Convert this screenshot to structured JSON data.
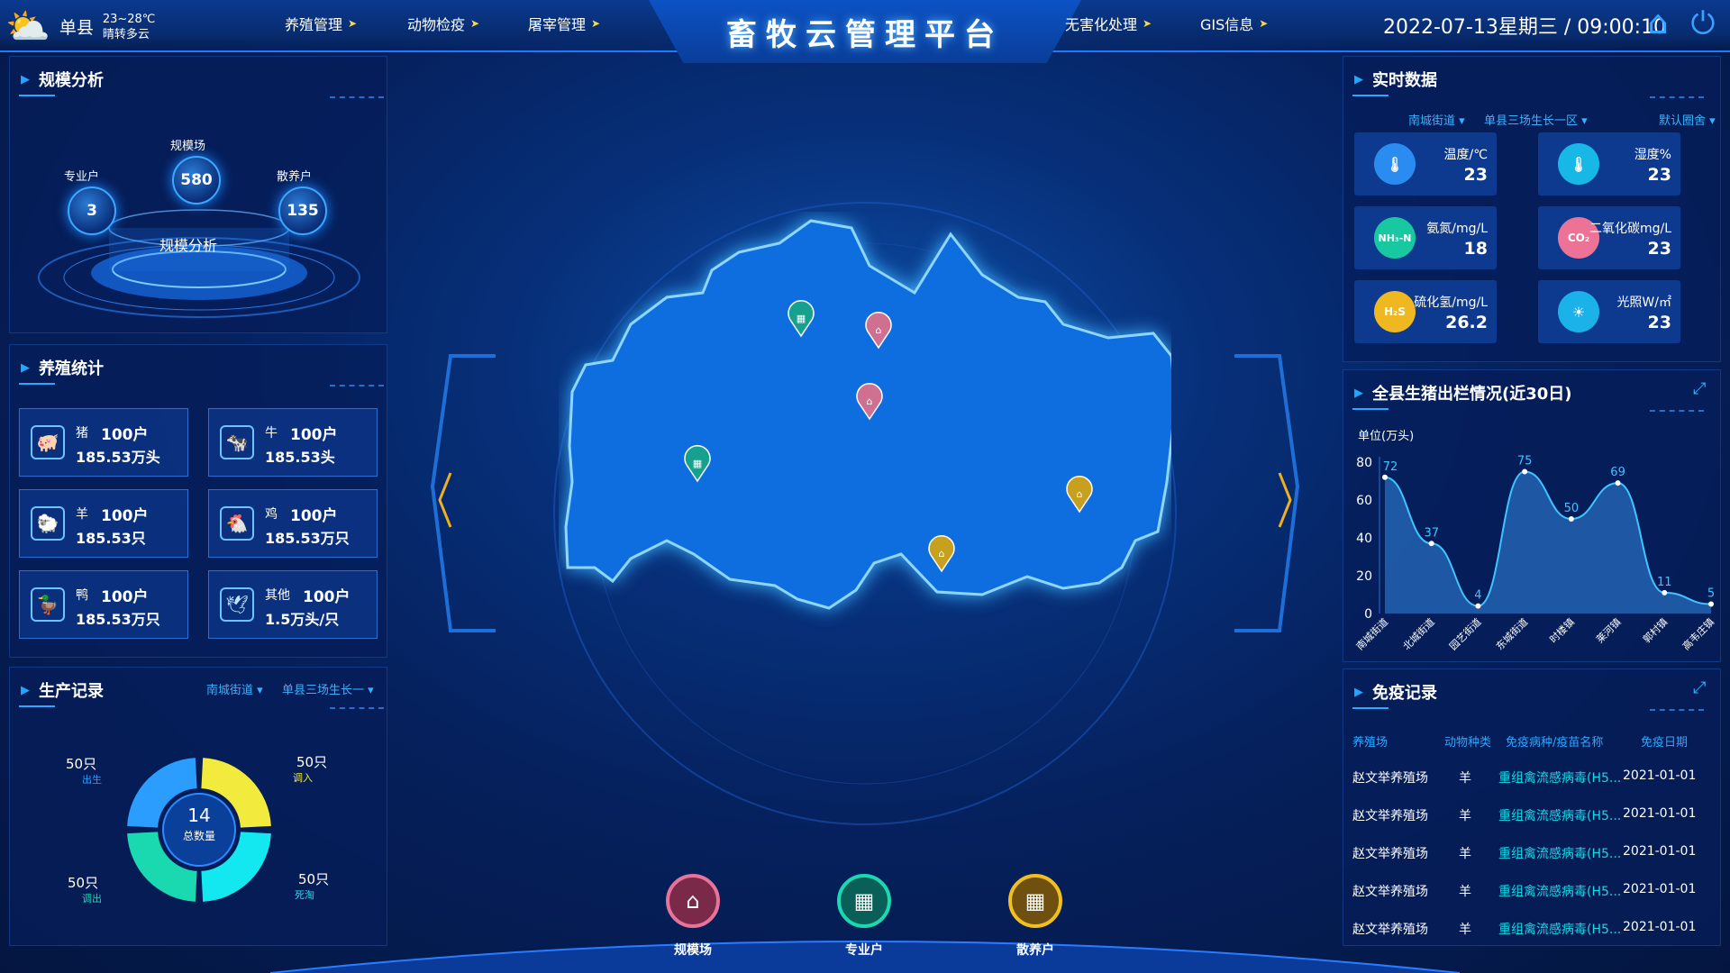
{
  "header": {
    "title": "畜牧云管理平台",
    "city": "单县",
    "temp": "23~28℃",
    "weather": "晴转多云",
    "datetime": "2022-07-13星期三 / 09:00:10",
    "nav_left": [
      "养殖管理",
      "动物检疫",
      "屠宰管理"
    ],
    "nav_right": [
      "无害化处理",
      "GIS信息"
    ]
  },
  "scale": {
    "title": "规模分析",
    "center_label": "规模分析",
    "items": [
      {
        "label": "专业户",
        "value": "3"
      },
      {
        "label": "规模场",
        "value": "580"
      },
      {
        "label": "散养户",
        "value": "135"
      }
    ]
  },
  "breed": {
    "title": "养殖统计",
    "items": [
      {
        "name": "猪",
        "count": "100户",
        "value": "185.53万头",
        "icon": "pig-icon"
      },
      {
        "name": "牛",
        "count": "100户",
        "value": "185.53头",
        "icon": "cow-icon"
      },
      {
        "name": "羊",
        "count": "100户",
        "value": "185.53只",
        "icon": "sheep-icon"
      },
      {
        "name": "鸡",
        "count": "100户",
        "value": "185.53万只",
        "icon": "chicken-icon"
      },
      {
        "name": "鸭",
        "count": "100户",
        "value": "185.53万只",
        "icon": "duck-icon"
      },
      {
        "name": "其他",
        "count": "100户",
        "value": "1.5万头/只",
        "icon": "bird-icon"
      }
    ]
  },
  "production": {
    "title": "生产记录",
    "filter1": "南城街道",
    "filter2": "单县三场生长一",
    "center_value": "14",
    "center_label": "总数量",
    "slices": [
      {
        "name": "出生",
        "value": "50只",
        "color": "#2a9dff"
      },
      {
        "name": "调入",
        "value": "50只",
        "color": "#f2ea3c"
      },
      {
        "name": "死淘",
        "value": "50只",
        "color": "#13e8f0"
      },
      {
        "name": "调出",
        "value": "50只",
        "color": "#1ad9b0"
      }
    ]
  },
  "realtime": {
    "title": "实时数据",
    "filter1": "南城街道",
    "filter2": "单县三场生长一区",
    "filter3": "默认圈舍",
    "items": [
      {
        "label": "温度/℃",
        "value": "23",
        "color": "#2a8cf0",
        "icon": "thermometer-icon",
        "glyph": "🌡"
      },
      {
        "label": "湿度%",
        "value": "23",
        "color": "#17b8e8",
        "icon": "humidity-icon",
        "glyph": "🌡"
      },
      {
        "label": "氨氮/mg/L",
        "value": "18",
        "color": "#18c8a0",
        "icon": "nh3-icon",
        "glyph": "NH₃-N"
      },
      {
        "label": "二氧化碳mg/L",
        "value": "23",
        "color": "#ec7296",
        "icon": "co2-icon",
        "glyph": "CO₂"
      },
      {
        "label": "硫化氢/mg/L",
        "value": "26.2",
        "color": "#f0b820",
        "icon": "h2s-icon",
        "glyph": "H₂S"
      },
      {
        "label": "光照W/㎡",
        "value": "23",
        "color": "#1ab2e8",
        "icon": "light-icon",
        "glyph": "☀"
      }
    ]
  },
  "pig_chart": {
    "title": "全县生猪出栏情况(近30日)",
    "unit": "单位(万头)"
  },
  "chart_data": {
    "type": "area",
    "title": "全县生猪出栏情况(近30日)",
    "ylabel": "单位(万头)",
    "categories": [
      "南城街道",
      "北城街道",
      "园艺街道",
      "东城街道",
      "时楼镇",
      "莱河镇",
      "郭村镇",
      "高韦庄镇"
    ],
    "values": [
      72,
      37,
      4,
      75,
      50,
      69,
      11,
      5
    ],
    "ylim": [
      0,
      80
    ],
    "yticks": [
      0,
      20,
      40,
      60,
      80
    ],
    "color": "#3ec4ff"
  },
  "vaccine": {
    "title": "免疫记录",
    "headers": [
      "养殖场",
      "动物种类",
      "免疫病种/疫苗名称",
      "免疫日期"
    ],
    "rows": [
      [
        "赵文举养殖场",
        "羊",
        "重组禽流感病毒(H5...",
        "2021-01-01"
      ],
      [
        "赵文举养殖场",
        "羊",
        "重组禽流感病毒(H5...",
        "2021-01-01"
      ],
      [
        "赵文举养殖场",
        "羊",
        "重组禽流感病毒(H5...",
        "2021-01-01"
      ],
      [
        "赵文举养殖场",
        "羊",
        "重组禽流感病毒(H5...",
        "2021-01-01"
      ],
      [
        "赵文举养殖场",
        "羊",
        "重组禽流感病毒(H5...",
        "2021-01-01"
      ]
    ]
  },
  "bottom": {
    "items": [
      {
        "label": "规模场",
        "color": "#e8739a"
      },
      {
        "label": "专业户",
        "color": "#1ad9b0"
      },
      {
        "label": "散养户",
        "color": "#f0c020"
      }
    ]
  }
}
